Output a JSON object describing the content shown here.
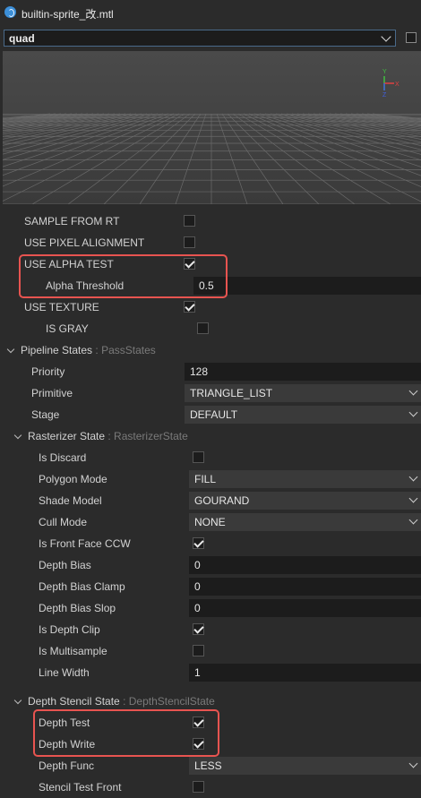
{
  "window": {
    "title": "builtin-sprite_改.mtl"
  },
  "mesh": {
    "selected": "quad",
    "checked": false
  },
  "sections": {
    "pipeline": {
      "label": "Pipeline States",
      "type": ": PassStates"
    },
    "rasterizer": {
      "label": "Rasterizer State",
      "type": ": RasterizerState"
    },
    "depth_stencil": {
      "label": "Depth Stencil State",
      "type": ": DepthStencilState"
    }
  },
  "props": {
    "sample_from_rt": {
      "label": "SAMPLE FROM RT",
      "checked": false
    },
    "use_pixel_alignment": {
      "label": "USE PIXEL ALIGNMENT",
      "checked": false
    },
    "use_alpha_test": {
      "label": "USE ALPHA TEST",
      "checked": true
    },
    "alpha_threshold": {
      "label": "Alpha Threshold",
      "value": "0.5"
    },
    "use_texture": {
      "label": "USE TEXTURE",
      "checked": true
    },
    "is_gray": {
      "label": "IS GRAY",
      "checked": false
    },
    "priority": {
      "label": "Priority",
      "value": "128"
    },
    "primitive": {
      "label": "Primitive",
      "value": "TRIANGLE_LIST"
    },
    "stage": {
      "label": "Stage",
      "value": "DEFAULT"
    },
    "is_discard": {
      "label": "Is Discard",
      "checked": false
    },
    "polygon_mode": {
      "label": "Polygon Mode",
      "value": "FILL"
    },
    "shade_model": {
      "label": "Shade Model",
      "value": "GOURAND"
    },
    "cull_mode": {
      "label": "Cull Mode",
      "value": "NONE"
    },
    "front_face_ccw": {
      "label": "Is Front Face CCW",
      "checked": true
    },
    "depth_bias": {
      "label": "Depth Bias",
      "value": "0"
    },
    "depth_bias_clamp": {
      "label": "Depth Bias Clamp",
      "value": "0"
    },
    "depth_bias_slop": {
      "label": "Depth Bias Slop",
      "value": "0"
    },
    "is_depth_clip": {
      "label": "Is Depth Clip",
      "checked": true
    },
    "is_multisample": {
      "label": "Is Multisample",
      "checked": false
    },
    "line_width": {
      "label": "Line Width",
      "value": "1"
    },
    "depth_test": {
      "label": "Depth Test",
      "checked": true
    },
    "depth_write": {
      "label": "Depth Write",
      "checked": true
    },
    "depth_func": {
      "label": "Depth Func",
      "value": "LESS"
    },
    "stencil_test_front": {
      "label": "Stencil Test Front",
      "checked": false
    }
  },
  "axes": {
    "x": "X",
    "y": "Y",
    "z": "Z"
  },
  "colors": {
    "highlight": "#e85450",
    "x_axis": "#e04040",
    "y_axis": "#40c040",
    "z_axis": "#4060e0"
  }
}
